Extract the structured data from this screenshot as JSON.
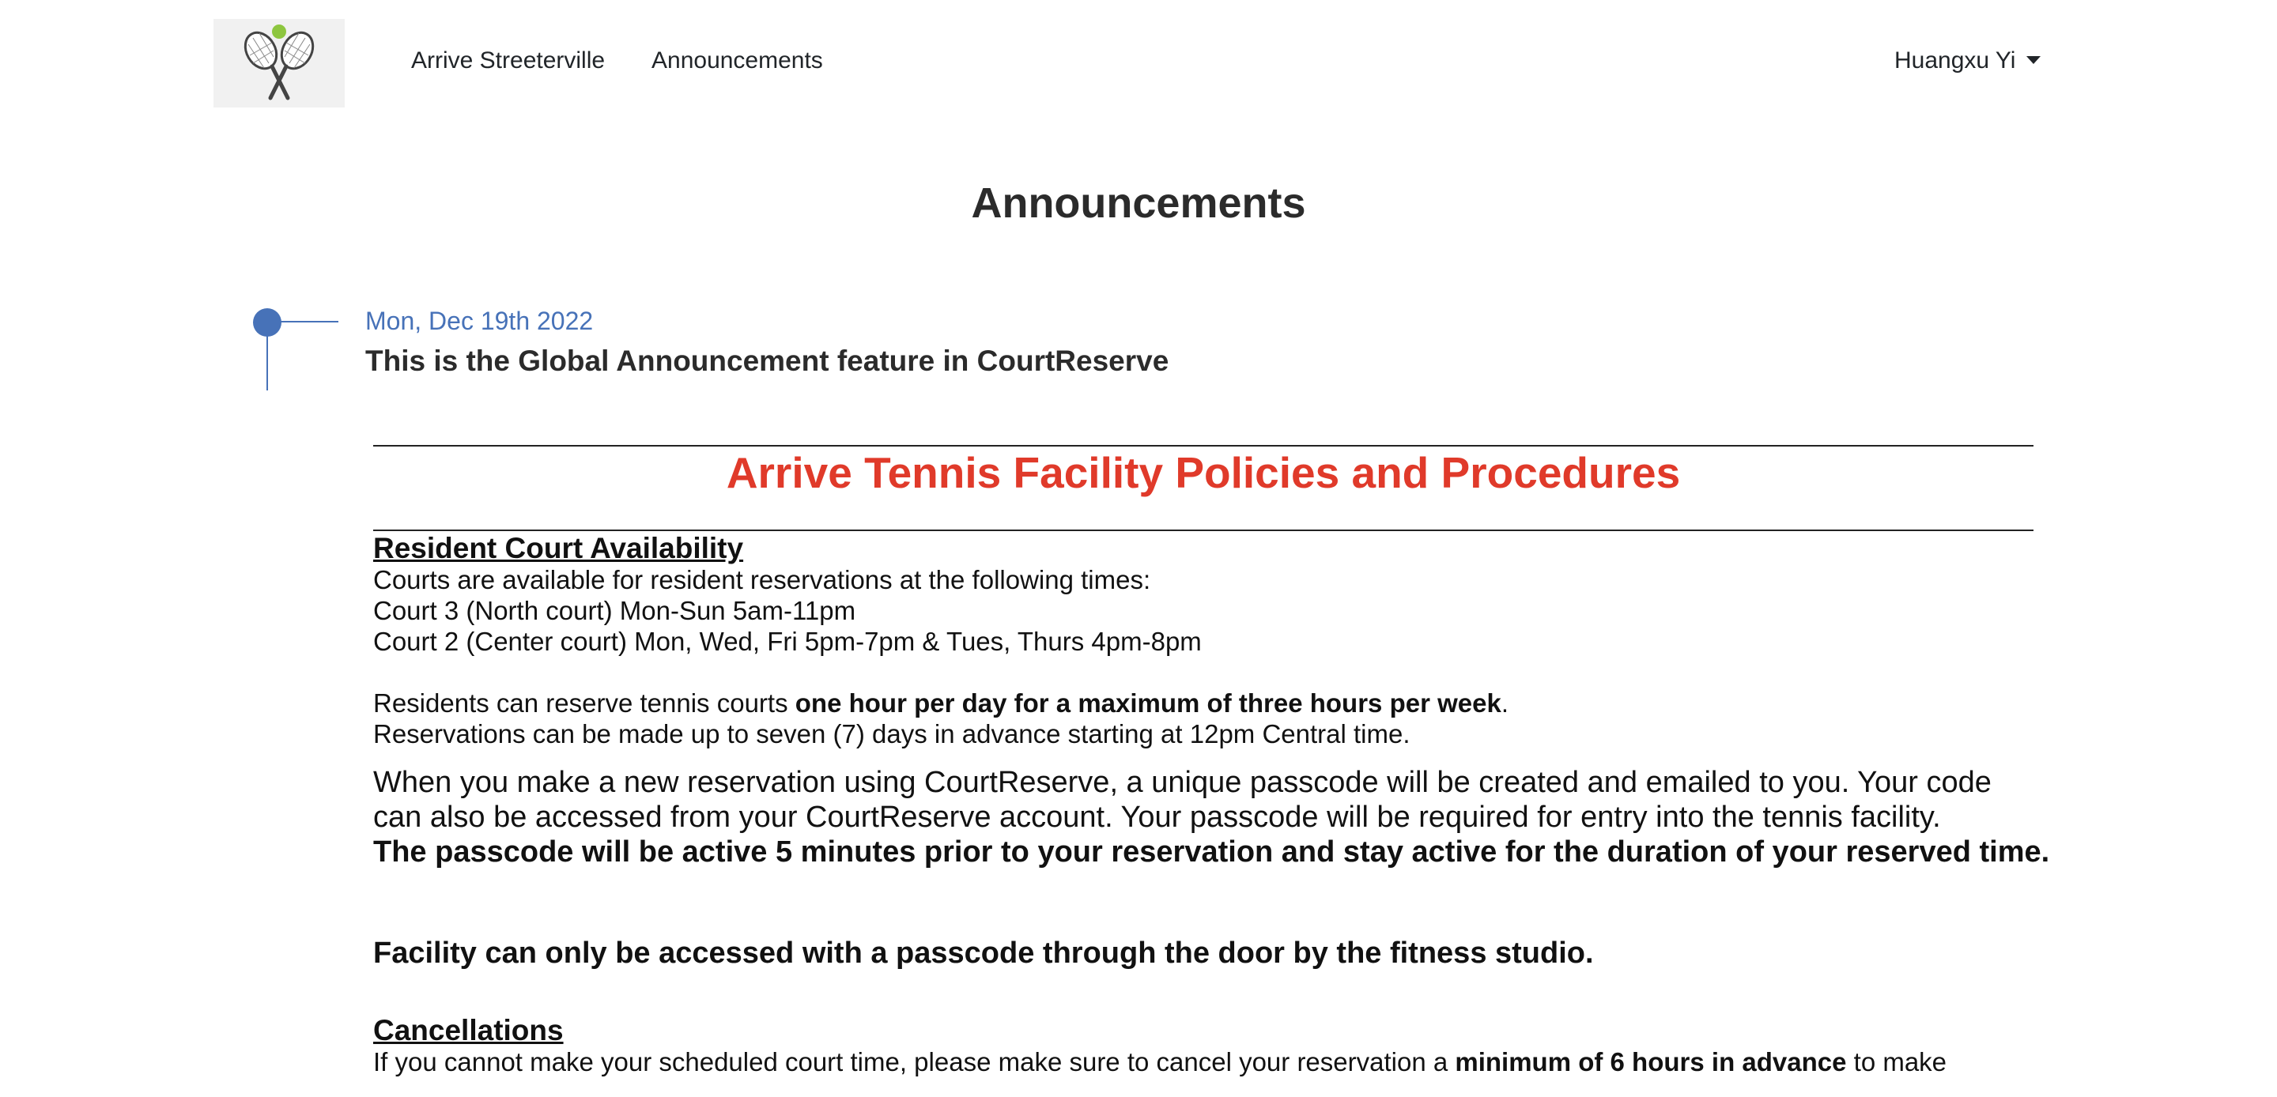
{
  "logo": {
    "icon": "tennis-rackets-logo-icon",
    "ball_color": "#8dc63f"
  },
  "nav": {
    "items": [
      {
        "label": "Arrive Streeterville"
      },
      {
        "label": "Announcements"
      }
    ]
  },
  "user": {
    "name": "Huangxu Yi"
  },
  "page": {
    "title": "Announcements"
  },
  "announcement": {
    "date": "Mon, Dec 19th 2022",
    "heading": "This is the Global Announcement feature in CourtReserve",
    "accent_color": "#4772b8"
  },
  "policy": {
    "title": "Arrive Tennis Facility Policies and Procedures",
    "title_color": "#e03a2a",
    "availability": {
      "heading": "Resident Court Availability",
      "lines": [
        "Courts are available for resident reservations at the following times:",
        "Court 3 (North court) Mon-Sun 5am-11pm",
        "Court 2 (Center court) Mon, Wed, Fri 5pm-7pm & Tues, Thurs 4pm-8pm"
      ]
    },
    "limits": {
      "prefix": "Residents can reserve tennis courts ",
      "bold": "one hour per day for a maximum of three hours per week",
      "suffix": ".",
      "advance": "Reservations can be made up to seven (7) days in advance starting at 12pm Central time."
    },
    "passcode": {
      "line1": "When you make a new reservation using CourtReserve, a unique passcode will be created and emailed to you. Your code",
      "line2": "can also be accessed from your CourtReserve account. Your passcode will be required for entry into the tennis facility.",
      "bold_line": "The passcode will be active 5 minutes prior to your reservation and stay active for the duration of your reserved time."
    },
    "access": "Facility can only be accessed with a passcode through the door by the fitness studio.",
    "cancellations": {
      "heading": "Cancellations",
      "prefix": "If you cannot make your scheduled court time, please make sure to cancel your reservation a ",
      "bold": "minimum of 6 hours in advance",
      "suffix": " to make"
    }
  }
}
